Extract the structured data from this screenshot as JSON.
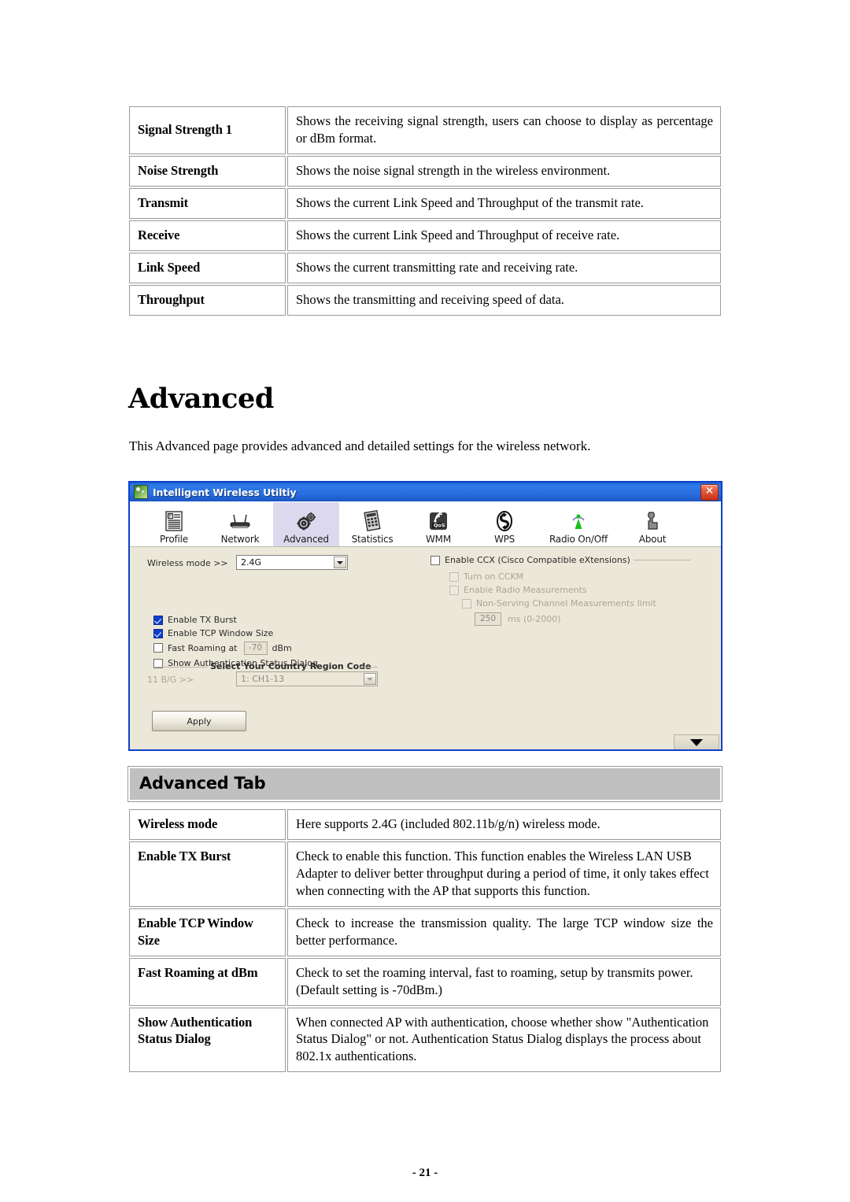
{
  "document": {
    "page_footer": "- 21 -",
    "heading": "Advanced",
    "intro": "This Advanced page provides advanced and detailed settings for the wireless network."
  },
  "status_table": {
    "rows": [
      {
        "label": "Signal Strength 1",
        "desc": "Shows the receiving signal strength, users can choose to display as percentage or dBm format."
      },
      {
        "label": "Noise Strength",
        "desc": "Shows the noise signal strength in the wireless environment."
      },
      {
        "label": "Transmit",
        "desc": "Shows the current Link Speed and Throughput of the transmit rate."
      },
      {
        "label": "Receive",
        "desc": "Shows the current Link Speed and Throughput of receive rate."
      },
      {
        "label": "Link Speed",
        "desc": "Shows the current transmitting rate and receiving rate."
      },
      {
        "label": "Throughput",
        "desc": "Shows the transmitting and receiving speed of data."
      }
    ]
  },
  "screenshot": {
    "window": {
      "title": "Intelligent Wireless Utiltiy",
      "app_icon": "wireless-utility-icon",
      "close_label": "✕"
    },
    "toolbar": {
      "tabs": [
        {
          "label": "Profile",
          "icon": "profile-icon",
          "selected": false
        },
        {
          "label": "Network",
          "icon": "network-icon",
          "selected": false
        },
        {
          "label": "Advanced",
          "icon": "gears-icon",
          "selected": true
        },
        {
          "label": "Statistics",
          "icon": "calculator-icon",
          "selected": false
        },
        {
          "label": "WMM",
          "icon": "qos-icon",
          "selected": false
        },
        {
          "label": "WPS",
          "icon": "wps-icon",
          "selected": false
        },
        {
          "label": "Radio On/Off",
          "icon": "antenna-icon",
          "selected": false
        },
        {
          "label": "About",
          "icon": "about-icon",
          "selected": false
        }
      ]
    },
    "left_panel": {
      "wireless_mode_label": "Wireless mode >>",
      "wireless_mode_value": "2.4G",
      "tx_burst_label": "Enable TX Burst",
      "tx_burst_checked": true,
      "tcp_window_label": "Enable TCP Window Size",
      "tcp_window_checked": true,
      "fast_roaming_label": "Fast Roaming at",
      "fast_roaming_checked": false,
      "fast_roaming_value": "-70",
      "fast_roaming_unit": "dBm",
      "auth_dialog_label": "Show Authentication Status Dialog",
      "auth_dialog_checked": false,
      "country_group_label": "Select Your Country Region Code",
      "band_label": "11 B/G >>",
      "region_value": "1: CH1-13"
    },
    "right_panel": {
      "ccx_label": "Enable CCX (Cisco Compatible eXtensions)",
      "ccx_checked": false,
      "cckm_label": "Turn on CCKM",
      "cckm_checked": false,
      "radio_meas_label": "Enable Radio Measurements",
      "radio_meas_checked": false,
      "nonserving_label": "Non-Serving Channel Measurements limit",
      "nonserving_checked": false,
      "limit_value": "250",
      "limit_unit": "ms (0-2000)"
    },
    "buttons": {
      "apply_label": "Apply",
      "expand_icon": "chevron-down-icon"
    }
  },
  "advanced_table": {
    "caption": "Advanced Tab",
    "rows": [
      {
        "label": "Wireless mode",
        "desc": "Here supports 2.4G (included 802.11b/g/n) wireless mode."
      },
      {
        "label": "Enable TX Burst",
        "desc": "Check to enable this function. This function enables the Wireless LAN USB Adapter to deliver better throughput during a period of time, it only takes effect when connecting with the AP that supports this function."
      },
      {
        "label": "Enable TCP Window Size",
        "desc": "Check to increase the transmission quality. The large TCP window size the better performance."
      },
      {
        "label": "Fast Roaming at dBm",
        "desc": "Check to set the roaming interval, fast to roaming, setup by transmits power. (Default setting is -70dBm.)"
      },
      {
        "label": "Show Authentication Status Dialog",
        "desc": "When connected AP with authentication, choose whether show \"Authentication Status Dialog\" or not. Authentication Status Dialog displays the process about 802.1x authentications."
      }
    ]
  },
  "colors": {
    "title_bar_blue": "#2a6ee0",
    "window_border": "#1040c8",
    "panel_beige": "#ece8d9",
    "selected_tab": "#dcd9ee",
    "caption_gray": "#c0c0c0",
    "checkbox_blue": "#0a3fcc",
    "close_red": "#c63217"
  }
}
